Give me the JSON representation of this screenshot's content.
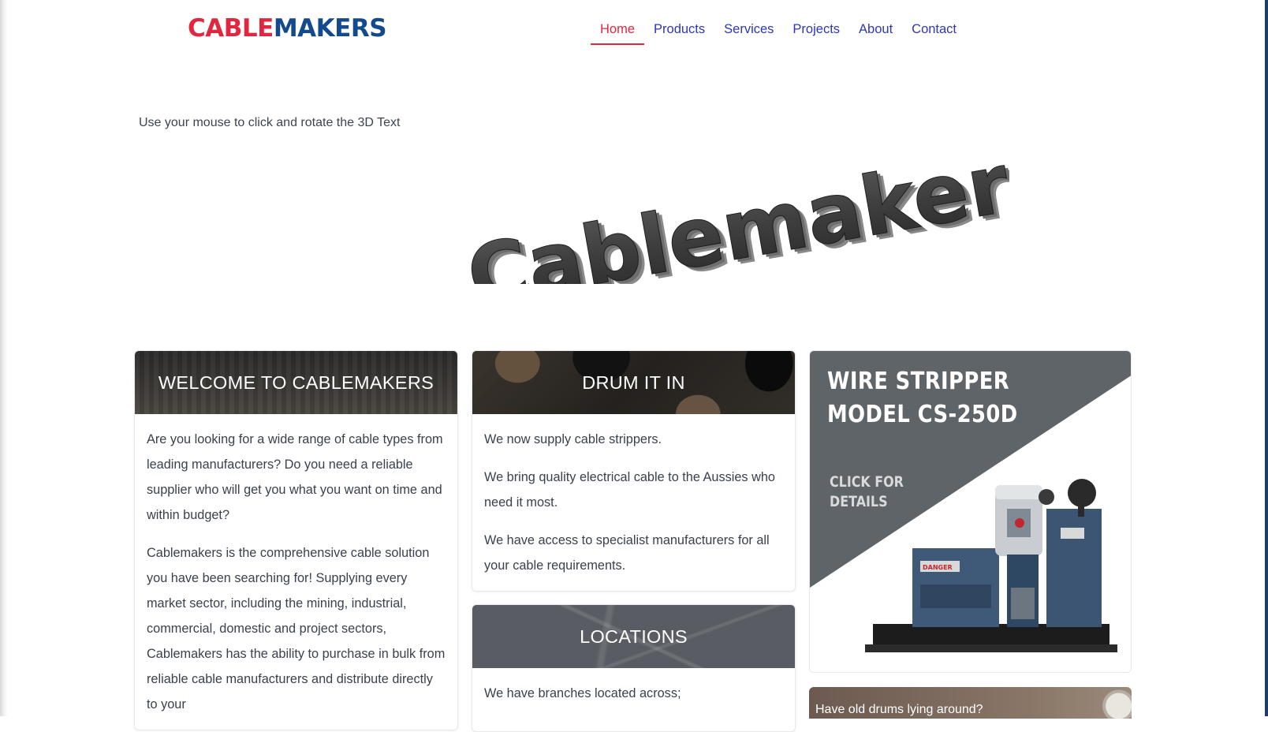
{
  "brand": {
    "part1": "CABLE",
    "part2": "MAKERS"
  },
  "nav": [
    {
      "label": "Home",
      "active": true
    },
    {
      "label": "Products",
      "active": false
    },
    {
      "label": "Services",
      "active": false
    },
    {
      "label": "Projects",
      "active": false
    },
    {
      "label": "About",
      "active": false
    },
    {
      "label": "Contact",
      "active": false
    }
  ],
  "hero": {
    "hint": "Use your mouse to click and rotate the 3D Text",
    "text3d": "Cablemakers"
  },
  "welcome": {
    "title": "WELCOME TO CABLEMAKERS",
    "paragraphs": [
      "Are you looking for a wide range of cable types from leading manufacturers? Do you need a reliable supplier who will get you what you want on time and within budget?",
      "Cablemakers is the comprehensive cable solution you have been searching for! Supplying every market sector, including the mining, industrial, commercial, domestic and project sectors, Cablemakers has the ability to purchase in bulk from reliable cable manufacturers and distribute directly to your"
    ]
  },
  "drum": {
    "title": "DRUM IT IN",
    "paragraphs": [
      "We now supply cable strippers.",
      "We bring quality electrical cable to the Aussies who need it most.",
      "We have access to specialist manufacturers for all your cable requirements."
    ]
  },
  "locations": {
    "title": "LOCATIONS",
    "paragraphs": [
      "We have branches located across;"
    ]
  },
  "promo": {
    "line1": "WIRE STRIPPER",
    "line2": "MODEL CS-250D",
    "cta1": "CLICK FOR",
    "cta2": "DETAILS",
    "danger": "DANGER"
  },
  "drums_teaser": {
    "text": "Have old drums lying around?"
  },
  "colors": {
    "brand_red": "#e3263f",
    "brand_blue": "#134a8e",
    "nav_link": "#2f36b8",
    "promo_grey": "#5f6469"
  }
}
